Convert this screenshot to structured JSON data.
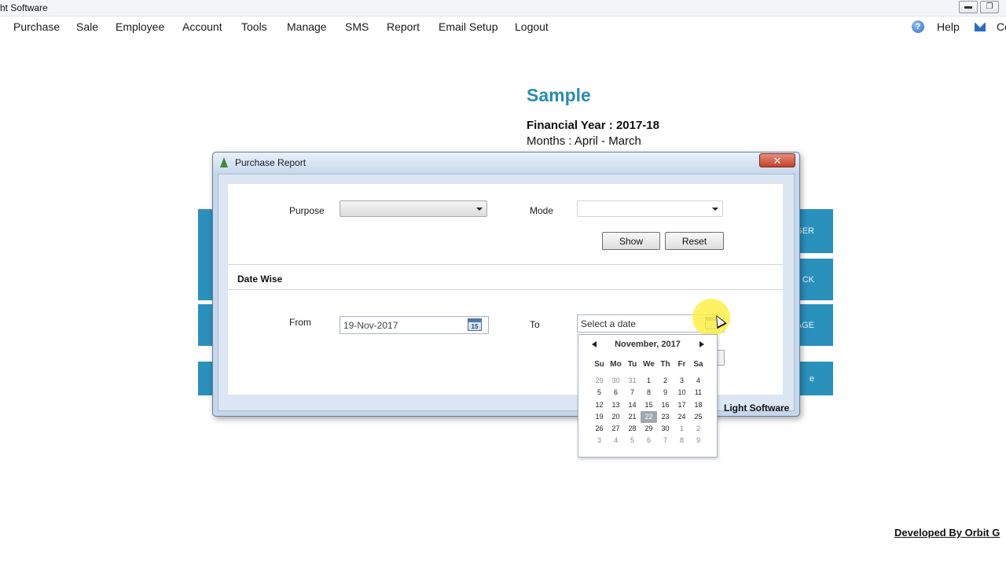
{
  "window": {
    "title": "ht Software",
    "min_glyph": "▬",
    "restore_glyph": "❐"
  },
  "menu": {
    "items": [
      "Purchase",
      "Sale",
      "Employee",
      "Account",
      "Tools",
      "Manage",
      "SMS",
      "Report",
      "Email Setup",
      "Logout"
    ],
    "help_label": "Help",
    "contact_label": "Co"
  },
  "company": {
    "name": "Sample",
    "financial_year": "Financial Year : 2017-18",
    "months": "Months : April - March"
  },
  "tiles": [
    "GER",
    "CK",
    "AGE",
    "e"
  ],
  "footer": {
    "developer": "Developed By Orbit G"
  },
  "dialog": {
    "title": "Purchase Report",
    "close_glyph": "✕",
    "purpose_label": "Purpose",
    "purpose_value": "",
    "mode_label": "Mode",
    "mode_value": "",
    "show_label": "Show",
    "reset_label": "Reset",
    "section_title": "Date Wise",
    "from_label": "From",
    "from_value": "19-Nov-2017",
    "to_label": "To",
    "to_placeholder": "Select a date",
    "calendar_icon_text": "15",
    "brand": "Light Software"
  },
  "calendar": {
    "month_label": "November, 2017",
    "weekdays": [
      "Su",
      "Mo",
      "Tu",
      "We",
      "Th",
      "Fr",
      "Sa"
    ],
    "weeks": [
      [
        "29",
        "30",
        "31",
        "1",
        "2",
        "3",
        "4"
      ],
      [
        "5",
        "6",
        "7",
        "8",
        "9",
        "10",
        "11"
      ],
      [
        "12",
        "13",
        "14",
        "15",
        "16",
        "17",
        "18"
      ],
      [
        "19",
        "20",
        "21",
        "22",
        "23",
        "24",
        "25"
      ],
      [
        "26",
        "27",
        "28",
        "29",
        "30",
        "1",
        "2"
      ],
      [
        "3",
        "4",
        "5",
        "6",
        "7",
        "8",
        "9"
      ]
    ],
    "today": "22",
    "colors": {
      "today_bg": "#a0a8b0",
      "accent": "#2a91bd"
    }
  }
}
